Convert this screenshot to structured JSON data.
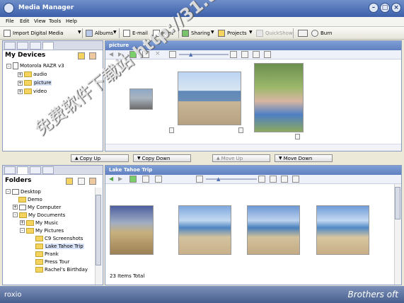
{
  "window": {
    "title": "Media Manager"
  },
  "menu": [
    "File",
    "Edit",
    "View",
    "Tools",
    "Help"
  ],
  "toolbar": {
    "import_label": "Import Digital Media",
    "albums_label": "Albums",
    "email_label": "E-mail",
    "print_label": "Print",
    "sharing_label": "Sharing",
    "projects_label": "Projects",
    "quickshow_label": "QuickShow",
    "burn_label": "Burn"
  },
  "devices_panel": {
    "title": "My Devices",
    "tree": [
      {
        "label": "Motorola RAZR v3",
        "level": 0
      },
      {
        "label": "audio",
        "level": 1
      },
      {
        "label": "picture",
        "level": 1
      },
      {
        "label": "video",
        "level": 1
      }
    ]
  },
  "picture_view": {
    "title": "picture"
  },
  "transfer_buttons": {
    "copy_up": "Copy Up",
    "copy_down": "Copy Down",
    "move_up": "Move Up",
    "move_down": "Move Down"
  },
  "folders_panel": {
    "title": "Folders",
    "tree": [
      {
        "label": "Desktop",
        "level": 0
      },
      {
        "label": "Demo",
        "level": 1
      },
      {
        "label": "My Computer",
        "level": 1
      },
      {
        "label": "My Documents",
        "level": 1
      },
      {
        "label": "My Music",
        "level": 2
      },
      {
        "label": "My Pictures",
        "level": 2
      },
      {
        "label": "C9 Screenshots",
        "level": 3
      },
      {
        "label": "Lake Tahoe Trip",
        "level": 3
      },
      {
        "label": "Prank",
        "level": 3
      },
      {
        "label": "Press Tour",
        "level": 3
      },
      {
        "label": "Rachel's Birthday",
        "level": 3
      }
    ]
  },
  "album_view": {
    "title": "Lake Tahoe Trip",
    "status": "23 Items Total"
  },
  "footer": {
    "brand": "roxio",
    "partner": "Brothers oft"
  },
  "watermark": {
    "text": "免费软件下载站 http://31.to"
  },
  "colors": {
    "title_blue": "#3c5fa9",
    "panel_header_blue": "#5f7fc0",
    "folder_yellow": "#f4d35e"
  }
}
